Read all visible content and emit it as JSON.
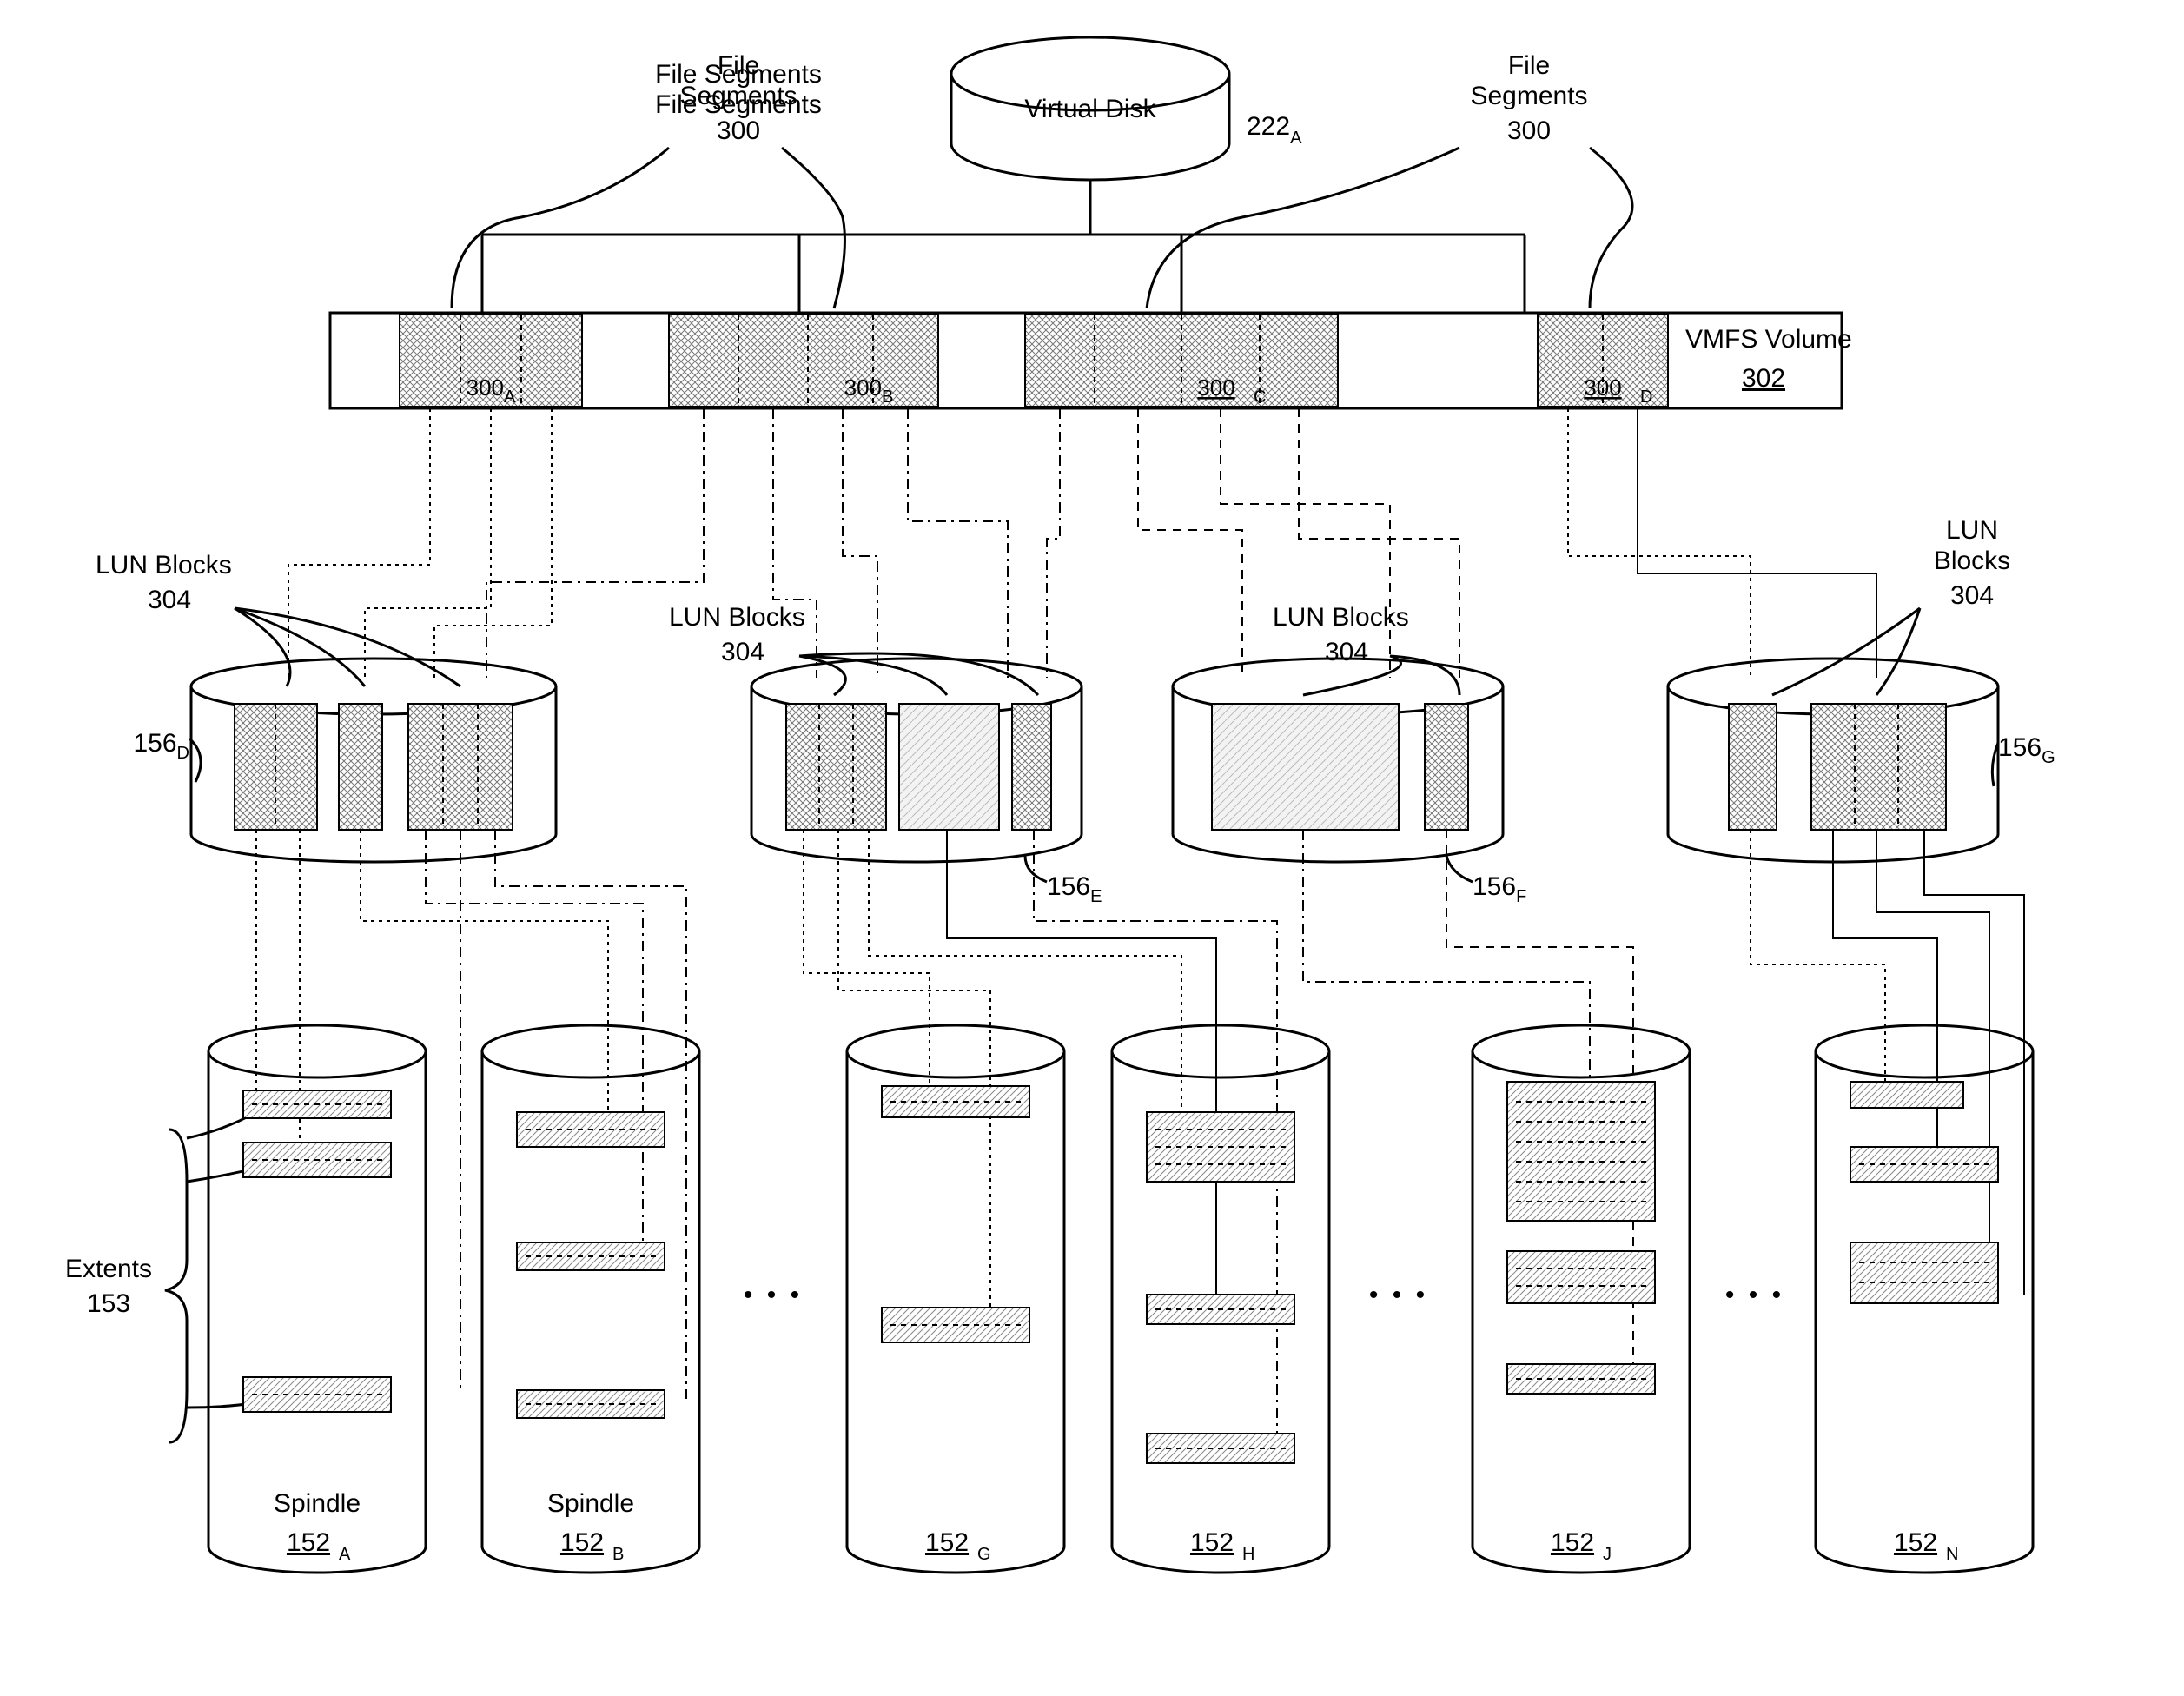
{
  "top": {
    "virtual_disk": "Virtual Disk",
    "virtual_disk_ref": "222",
    "virtual_disk_sub": "A",
    "file_segments": "File\nSegments",
    "file_segments_ref": "300"
  },
  "volume": {
    "name": "VMFS Volume",
    "ref": "302",
    "segs": [
      {
        "label": "300",
        "sub": "A"
      },
      {
        "label": "300",
        "sub": "B"
      },
      {
        "label": "300",
        "sub": "C"
      },
      {
        "label": "300",
        "sub": "D"
      }
    ]
  },
  "lun": {
    "label": "LUN Blocks",
    "label2": "LUN\nBlocks",
    "ref": "304",
    "disks": [
      {
        "ref": "156",
        "sub": "D"
      },
      {
        "ref": "156",
        "sub": "E"
      },
      {
        "ref": "156",
        "sub": "F"
      },
      {
        "ref": "156",
        "sub": "G"
      }
    ]
  },
  "spindle": {
    "label": "Spindle",
    "extents_label": "Extents",
    "extents_ref": "153",
    "ellipsis": "• • •",
    "items": [
      {
        "ref": "152",
        "sub": "A"
      },
      {
        "ref": "152",
        "sub": "B"
      },
      {
        "ref": "152",
        "sub": "G"
      },
      {
        "ref": "152",
        "sub": "H"
      },
      {
        "ref": "152",
        "sub": "J"
      },
      {
        "ref": "152",
        "sub": "N"
      }
    ]
  },
  "chart_data": {
    "type": "hierarchy-map",
    "description": "Mapping hierarchy: a Virtual Disk is stored as File Segments (300A-D) in a VMFS Volume (302); segments map to LUN Blocks (304) on LUNs 156D,156E,156F,156G; LUN blocks map to Extents (153) on physical Spindles 152A,152B,...,152G,152H,...,152J,...,152N.",
    "levels": [
      {
        "name": "Virtual Disk",
        "ids": [
          "222A"
        ]
      },
      {
        "name": "File Segments (VMFS Volume 302)",
        "ids": [
          "300A",
          "300B",
          "300C",
          "300D"
        ]
      },
      {
        "name": "LUN Blocks 304",
        "ids": [
          "156D",
          "156E",
          "156F",
          "156G"
        ]
      },
      {
        "name": "Spindle Extents 153",
        "ids": [
          "152A",
          "152B",
          "152G",
          "152H",
          "152J",
          "152N"
        ]
      }
    ]
  }
}
